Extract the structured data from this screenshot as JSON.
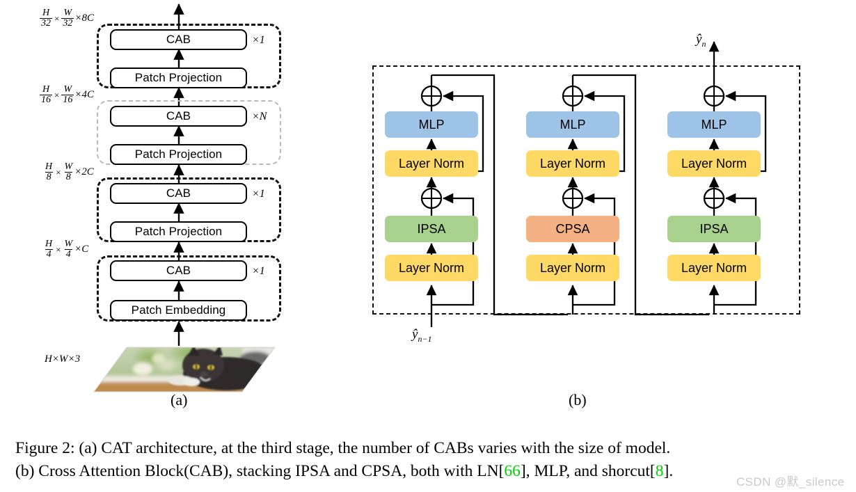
{
  "figure": {
    "caption_line1": "Figure 2: (a) CAT architecture, at the third stage, the number of CABs varies with the size of model.",
    "caption_line2_part1": "(b) Cross Attention Block(CAB), stacking IPSA and CPSA, both with LN[",
    "caption_cite1": "66",
    "caption_line2_part2": "], MLP, and shorcut[",
    "caption_cite2": "8",
    "caption_line2_part3": "].",
    "watermark": "CSDN @默_silence",
    "sublabel_a": "(a)",
    "sublabel_b": "(b)"
  },
  "panel_a": {
    "stages": [
      {
        "id": "stage4",
        "repeat": "×1",
        "dim": {
          "num1": "H",
          "den1": "32",
          "num2": "W",
          "den2": "32",
          "tail": "×8C"
        },
        "blocks": [
          "CAB",
          "Patch Projection"
        ],
        "border_color": "#111111"
      },
      {
        "id": "stage3",
        "repeat": "×N",
        "dim": {
          "num1": "H",
          "den1": "16",
          "num2": "W",
          "den2": "16",
          "tail": "×4C"
        },
        "blocks": [
          "CAB",
          "Patch Projection"
        ],
        "border_color": "#b9b9b9"
      },
      {
        "id": "stage2",
        "repeat": "×1",
        "dim": {
          "num1": "H",
          "den1": "8",
          "num2": "W",
          "den2": "8",
          "tail": "×2C"
        },
        "blocks": [
          "CAB",
          "Patch Projection"
        ],
        "border_color": "#111111"
      },
      {
        "id": "stage1",
        "repeat": "×1",
        "dim": {
          "num1": "H",
          "den1": "4",
          "num2": "W",
          "den2": "4",
          "tail": "×C"
        },
        "blocks": [
          "CAB",
          "Patch Embedding"
        ],
        "border_color": "#111111"
      }
    ],
    "input_label": "H×W×3",
    "input_image_alt": "photo of a black cat lying on a wooden surface"
  },
  "panel_b": {
    "input_label": "ŷ",
    "input_sub": "n−1",
    "output_label": "ŷ",
    "output_sub": "n",
    "sub_blocks": [
      {
        "id": "sub-block-1",
        "attention": "IPSA",
        "attention_color": "#a9d18e",
        "mlp": "MLP",
        "mlp_color": "#9dc3e6",
        "norm_lower": "Layer Norm",
        "norm_upper": "Layer Norm",
        "norm_color": "#ffd966"
      },
      {
        "id": "sub-block-2",
        "attention": "CPSA",
        "attention_color": "#f4b183",
        "mlp": "MLP",
        "mlp_color": "#9dc3e6",
        "norm_lower": "Layer Norm",
        "norm_upper": "Layer Norm",
        "norm_color": "#ffd966"
      },
      {
        "id": "sub-block-3",
        "attention": "IPSA",
        "attention_color": "#a9d18e",
        "mlp": "MLP",
        "mlp_color": "#9dc3e6",
        "norm_lower": "Layer Norm",
        "norm_upper": "Layer Norm",
        "norm_color": "#ffd966"
      }
    ],
    "add_symbol": "⊕"
  }
}
